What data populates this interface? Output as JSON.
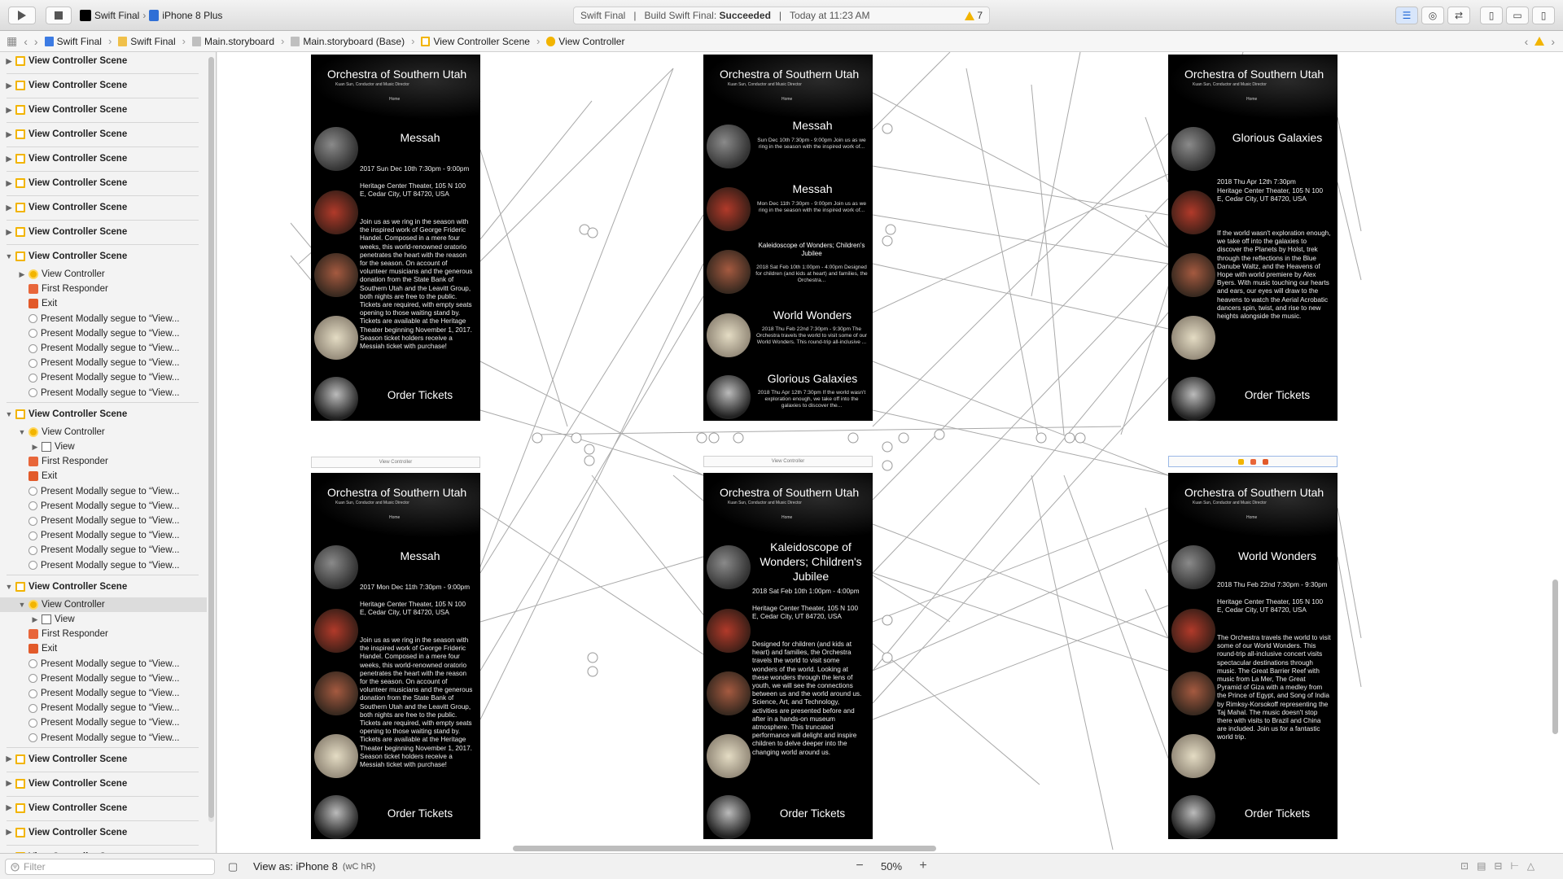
{
  "toolbar": {
    "scheme_name": "Swift Final",
    "device": "iPhone 8 Plus",
    "status_project": "Swift Final",
    "status_build_label": "Build Swift Final:",
    "status_build_result": "Succeeded",
    "status_time": "Today at 11:23 AM",
    "warning_count": "7"
  },
  "jumpbar": {
    "crumbs": [
      "Swift Final",
      "Swift Final",
      "Main.storyboard",
      "Main.storyboard (Base)",
      "View Controller Scene",
      "View Controller"
    ]
  },
  "outline": {
    "scene": "View Controller Scene",
    "view_controller": "View Controller",
    "view": "View",
    "first_responder": "First Responder",
    "exit": "Exit",
    "segue": "Present Modally segue to “View..."
  },
  "canvas": {
    "org_title": "Orchestra of Southern Utah",
    "org_sub": "Kuan Sun, Conductor and Music Director",
    "home": "Home",
    "order": "Order Tickets",
    "vc_label": "View Controller",
    "p1": {
      "title": "Messah",
      "date": "2017 Sun Dec 10th 7:30pm - 9:00pm",
      "venue": "Heritage Center Theater, 105 N 100 E, Cedar City, UT 84720, USA",
      "desc": "Join us as we ring in the season with the inspired work of George Frideric Handel. Composed in a mere four weeks, this world-renowned oratorio penetrates the heart with the reason for the season. On account of volunteer musicians and the generous donation from the State Bank of Southern Utah and the Leavitt Group, both nights are free to the public. Tickets are required, with empty seats opening to those waiting stand by. Tickets are available at the Heritage Theater beginning November 1, 2017. Season ticket holders receive a Messiah ticket with purchase!"
    },
    "p2": {
      "e1_title": "Messah",
      "e1_text": "Sun Dec 10th 7:30pm - 9:00pm Join us as we ring in the season with the inspired work of...",
      "e2_title": "Messah",
      "e2_text": "Mon Dec 11th 7:30pm - 9:00pm Join us as we ring in the season with the inspired work of...",
      "e3_title": "Kaleidoscope of Wonders; Children's Jubilee",
      "e3_text": "2018 Sat Feb 10th 1:00pm - 4:00pm Designed for children (and kids at heart) and families, the Orchestra...",
      "e4_title": "World Wonders",
      "e4_text": "2018 Thu Feb 22nd 7:30pm - 9:30pm The Orchestra travels the world to visit some of our World Wonders. This round-trip all-inclusive ...",
      "e5_title": "Glorious Galaxies",
      "e5_text": "2018 Thu Apr 12th 7:30pm If the world wasn't exploration enough, we take off into the galaxies to discover the..."
    },
    "p3": {
      "title": "Glorious Galaxies",
      "date": "2018 Thu Apr 12th 7:30pm",
      "venue": "Heritage Center Theater, 105 N 100 E, Cedar City, UT 84720, USA",
      "desc": "If the world wasn't exploration enough, we take off into the galaxies to discover the Planets by Holst, trek through the reflections in the Blue Danube Waltz, and the Heavens of Hope with world premiere by Alex Byers. With music touching our hearts and ears, our eyes will draw to the heavens to watch the Aerial Acrobatic dancers spin, twist, and rise to new heights alongside the music."
    },
    "p4": {
      "title": "Messah",
      "date": "2017 Mon Dec 11th 7:30pm - 9:00pm",
      "venue": "Heritage Center Theater, 105 N 100 E, Cedar City, UT 84720, USA",
      "desc": "Join us as we ring in the season with the inspired work of George Frideric Handel. Composed in a mere four weeks, this world-renowned oratorio penetrates the heart with the reason for the season. On account of volunteer musicians and the generous donation from the State Bank of Southern Utah and the Leavitt Group, both nights are free to the public. Tickets are required, with empty seats opening to those waiting stand by. Tickets are available at the Heritage Theater beginning November 1, 2017. Season ticket holders receive a Messiah ticket with purchase!"
    },
    "p5": {
      "title": "Kaleidoscope of Wonders; Children's Jubilee",
      "date": "2018 Sat Feb 10th 1:00pm - 4:00pm",
      "venue": "Heritage Center Theater, 105 N 100 E, Cedar City, UT 84720, USA",
      "desc": "Designed for children (and kids at heart) and families, the Orchestra travels the world to visit some wonders of the world. Looking at these wonders through the lens of youth, we will see the connections between us and the world around us. Science, Art, and Technology, activities are presented before and after in a hands-on museum atmosphere. This truncated performance will delight and inspire children to delve deeper into the changing world around us."
    },
    "p6": {
      "title": "World Wonders",
      "date": "2018 Thu Feb 22nd 7:30pm - 9:30pm",
      "venue": "Heritage Center Theater, 105 N 100 E, Cedar City, UT 84720, USA",
      "desc": "The Orchestra travels the world to visit some of our World Wonders. This round-trip all-inclusive concert visits spectacular destinations through music. The Great Barrier Reef with music from La Mer, The Great Pyramid of Giza with a medley from the Prince of Egypt, and Song of India by Rimksy-Korsokoff representing the Taj Mahal. The music doesn't stop there with visits to Brazil and China are included. Join us for a fantastic world trip."
    }
  },
  "bottombar": {
    "filter_placeholder": "Filter",
    "view_as": "View as: iPhone 8",
    "size_class": "(wC hR)",
    "zoom": "50%"
  }
}
